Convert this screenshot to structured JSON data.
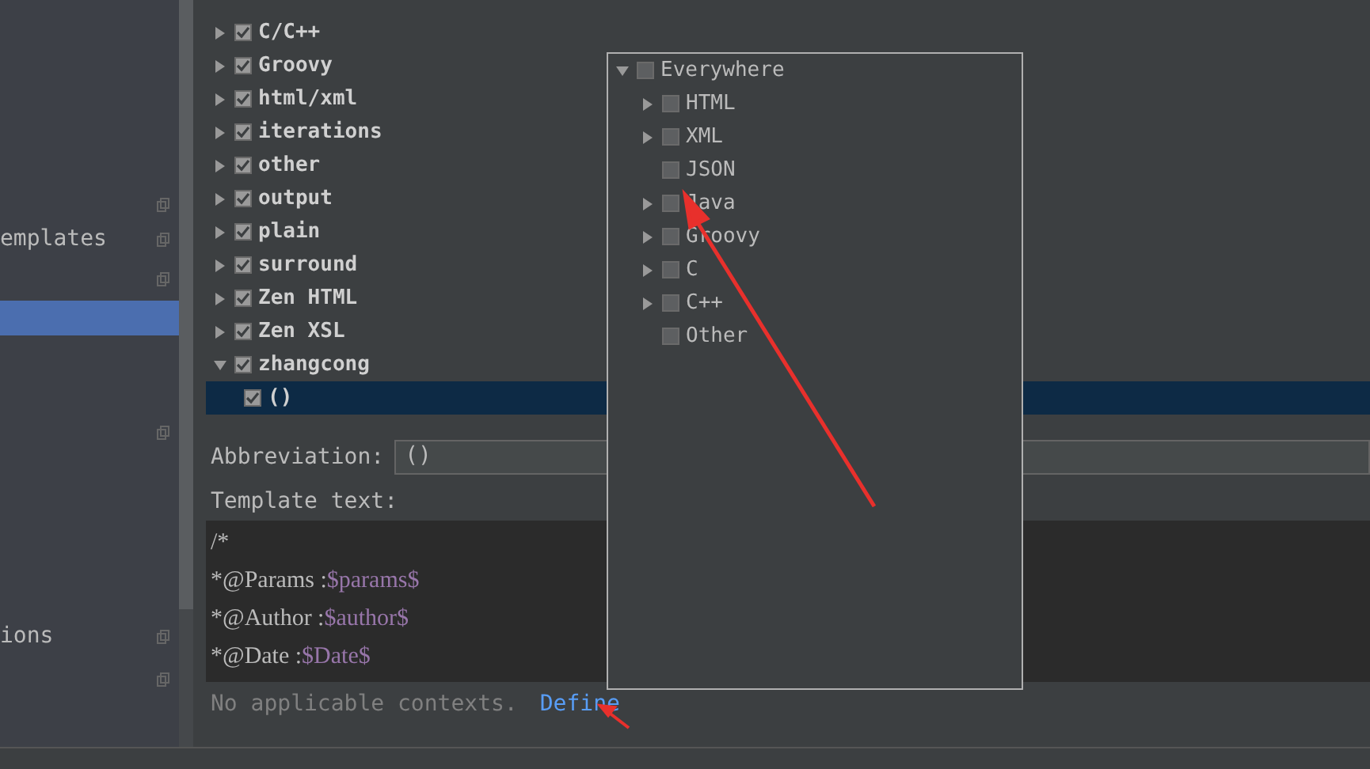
{
  "sidebar": {
    "items": [
      {
        "selected": false,
        "copy_icon": true
      },
      {
        "label": "emplates",
        "selected": false,
        "copy_icon": true
      },
      {
        "selected": false,
        "copy_icon": true
      },
      {
        "selected": true,
        "copy_icon": false
      },
      {
        "selected": false,
        "copy_icon": true
      },
      {
        "label": "ions",
        "selected": false,
        "copy_icon": true
      },
      {
        "selected": false,
        "copy_icon": true
      }
    ]
  },
  "template_tree": [
    {
      "label": "C/C++",
      "checked": true,
      "expanded": false
    },
    {
      "label": "Groovy",
      "checked": true,
      "expanded": false
    },
    {
      "label": "html/xml",
      "checked": true,
      "expanded": false
    },
    {
      "label": "iterations",
      "checked": true,
      "expanded": false
    },
    {
      "label": "other",
      "checked": true,
      "expanded": false
    },
    {
      "label": "output",
      "checked": true,
      "expanded": false
    },
    {
      "label": "plain",
      "checked": true,
      "expanded": false
    },
    {
      "label": "surround",
      "checked": true,
      "expanded": false
    },
    {
      "label": "Zen HTML",
      "checked": true,
      "expanded": false
    },
    {
      "label": "Zen XSL",
      "checked": true,
      "expanded": false
    },
    {
      "label": "zhangcong",
      "checked": true,
      "expanded": true,
      "children": [
        {
          "label": "()",
          "checked": true,
          "selected": true
        }
      ]
    }
  ],
  "abbreviation": {
    "label": "Abbreviation:",
    "value": "()"
  },
  "template_text": {
    "label": "Template text:",
    "lines": [
      {
        "text": "/*"
      },
      {
        "text": "*@Params :",
        "variable": "$params$"
      },
      {
        "text": "*@Author :",
        "variable": "$author$"
      },
      {
        "text": "*@Date :",
        "variable": "$Date$"
      }
    ]
  },
  "contexts": {
    "message": "No applicable contexts.",
    "link": "Define"
  },
  "context_popup": {
    "label": "Everywhere",
    "checked": false,
    "expanded": true,
    "children": [
      {
        "label": "HTML",
        "checked": false,
        "expandable": true
      },
      {
        "label": "XML",
        "checked": false,
        "expandable": true
      },
      {
        "label": "JSON",
        "checked": false,
        "expandable": false
      },
      {
        "label": "Java",
        "checked": false,
        "expandable": true
      },
      {
        "label": "Groovy",
        "checked": false,
        "expandable": true
      },
      {
        "label": "C",
        "checked": false,
        "expandable": true
      },
      {
        "label": "C++",
        "checked": false,
        "expandable": true
      },
      {
        "label": "Other",
        "checked": false,
        "expandable": false
      }
    ]
  }
}
